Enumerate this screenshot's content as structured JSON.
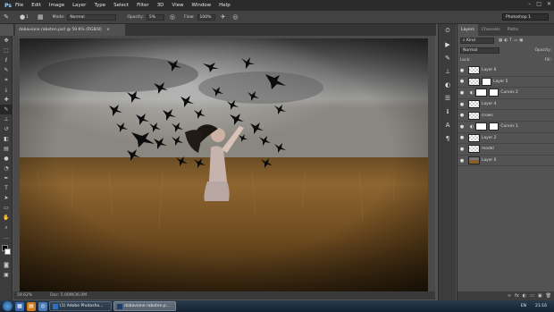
{
  "app": {
    "logo": "Ps",
    "menu": [
      "File",
      "Edit",
      "Image",
      "Layer",
      "Type",
      "Select",
      "Filter",
      "3D",
      "View",
      "Window",
      "Help"
    ],
    "window_controls": [
      "–",
      "□",
      "✕"
    ]
  },
  "options": {
    "mode_label": "Mode:",
    "mode_value": "Normal",
    "opacity_label": "Opacity:",
    "opacity_value": "5%",
    "flow_label": "Flow:",
    "flow_value": "100%",
    "brush_size": "1"
  },
  "workspace": "Photoshop 1",
  "document": {
    "tab_title": "dobaviane raboten.psd @ 59.6% (RGB/8)",
    "zoom": "59.62%",
    "doc_info": "Doc: 5.00M/36.0M"
  },
  "panel": {
    "tabs": [
      "Layers",
      "Channels",
      "Paths"
    ],
    "filter_kind": "Kind",
    "blend_mode": "Normal",
    "opacity_label": "Opacity:",
    "lock_label": "Lock:",
    "fill_label": "Fill:",
    "layers": [
      {
        "name": "Layer 6",
        "thumb": "checker",
        "mask": false,
        "adjust": false
      },
      {
        "name": "Layer 5",
        "thumb": "checker",
        "mask": true,
        "adjust": false
      },
      {
        "name": "Curves 2",
        "thumb": "white",
        "mask": true,
        "adjust": true
      },
      {
        "name": "Layer 4",
        "thumb": "checker",
        "mask": false,
        "adjust": false
      },
      {
        "name": "crows",
        "thumb": "checker",
        "mask": false,
        "adjust": false
      },
      {
        "name": "Curves 1",
        "thumb": "white",
        "mask": true,
        "adjust": true
      },
      {
        "name": "Layer 2",
        "thumb": "checker",
        "mask": false,
        "adjust": false
      },
      {
        "name": "model",
        "thumb": "checker",
        "mask": false,
        "adjust": false
      },
      {
        "name": "Layer 0",
        "thumb": "photo",
        "mask": false,
        "adjust": false
      }
    ],
    "footer_icons": [
      "∞",
      "fx",
      "◐",
      "▭",
      "▣",
      "🗑"
    ]
  },
  "taskbar": {
    "items": [
      {
        "label": "(1) Adobe Photosho...",
        "icon_color": "#2f6fc0",
        "active": false
      },
      {
        "label": "dobaviane raboten.p...",
        "icon_color": "#1b3e6b",
        "active": true
      }
    ],
    "lang": "EN",
    "clock": "21:16"
  },
  "colors": {
    "menubar": "#2b2b2b",
    "panel": "#535353",
    "accent": "#9fd3ff"
  }
}
